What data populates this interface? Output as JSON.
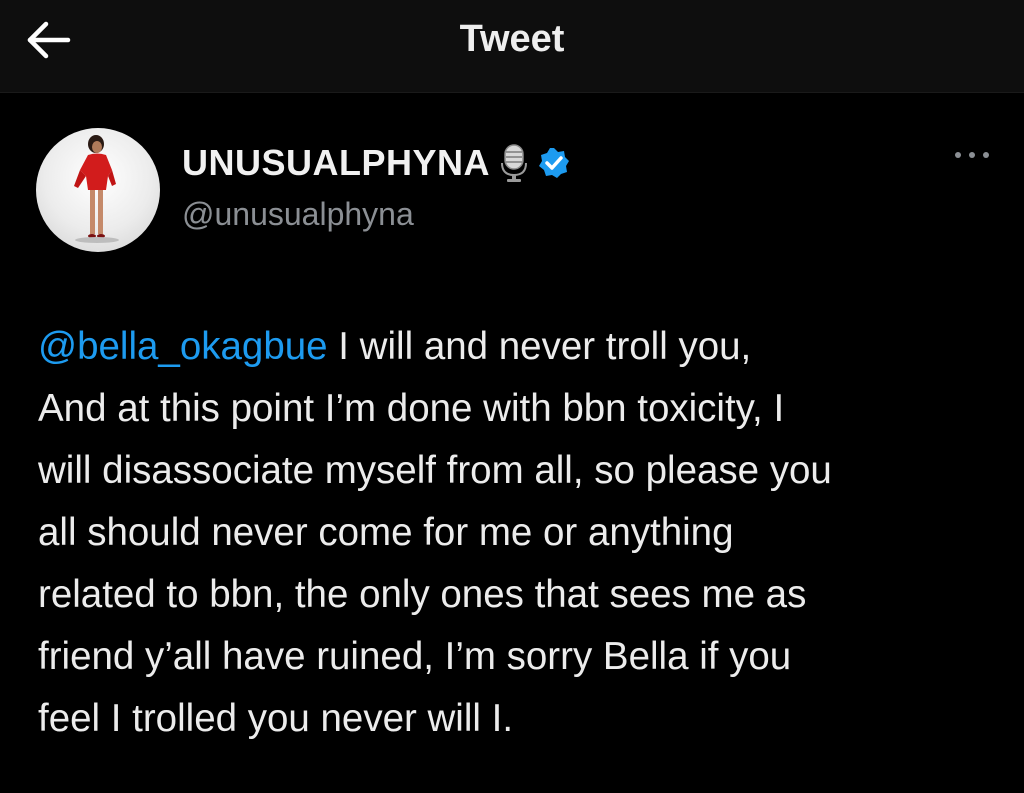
{
  "topbar": {
    "title": "Tweet",
    "back_icon": "arrow-left-icon"
  },
  "author": {
    "display_name": "UNUSUALPHYNA",
    "handle": "@unusualphyna",
    "name_emoji_icon": "microphone-icon",
    "verified_icon": "verified-badge-icon",
    "more_icon": "more-horizontal-icon"
  },
  "tweet": {
    "mention": "@bella_okagbue",
    "lines": [
      " I will and never troll you,",
      "And at this point I’m done with bbn toxicity, I",
      "will disassociate myself from all, so please you",
      "all should never come for me or anything",
      "related to bbn, the only ones that sees me as",
      "friend y’all have ruined, I’m sorry Bella if you",
      "feel I trolled you never will I."
    ]
  },
  "colors": {
    "background": "#000000",
    "topbar": "#0e0e0e",
    "text": "#e7e9ea",
    "secondary_text": "#8b8f94",
    "link": "#1d9bf0",
    "verified": "#1d9bf0"
  }
}
